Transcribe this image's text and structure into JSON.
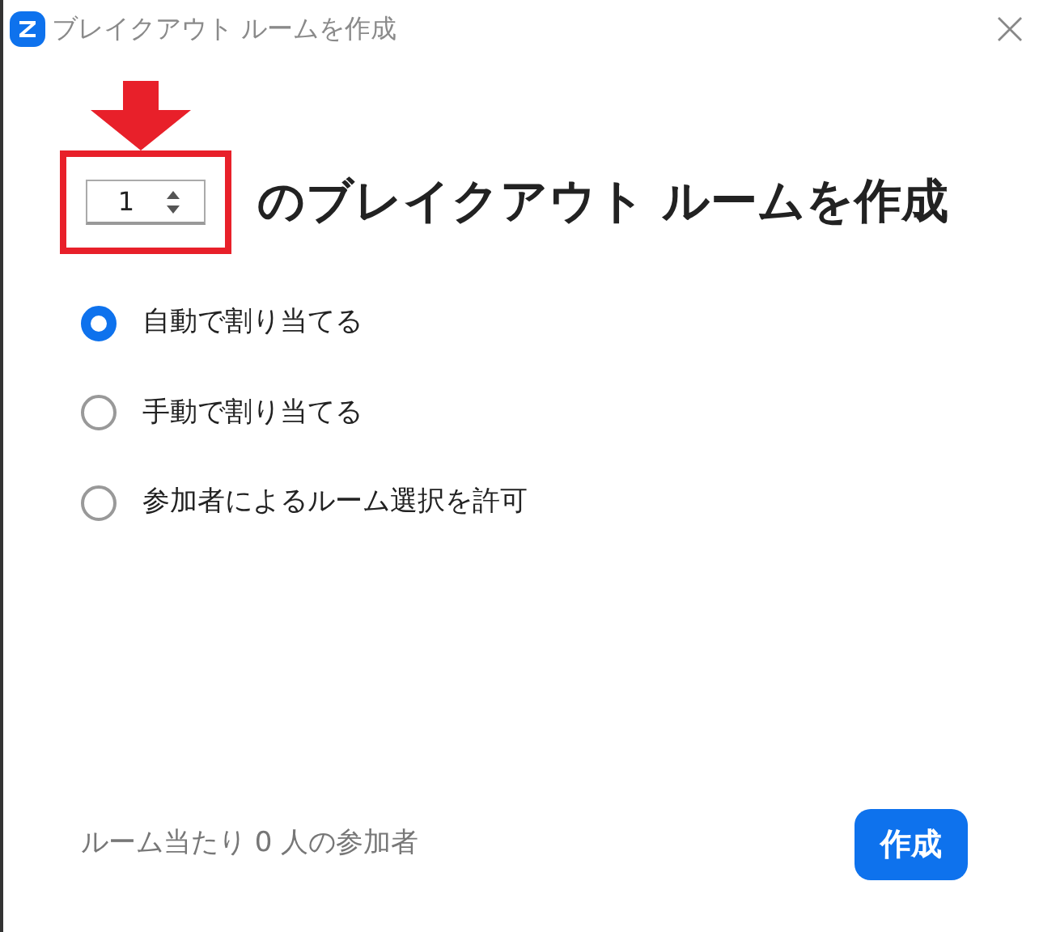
{
  "window": {
    "title": "ブレイクアウト ルームを作成"
  },
  "room_count": {
    "value": "1"
  },
  "headline": "のブレイクアウト ルームを作成",
  "options": [
    {
      "label": "自動で割り当てる",
      "selected": true
    },
    {
      "label": "手動で割り当てる",
      "selected": false
    },
    {
      "label": "参加者によるルーム選択を許可",
      "selected": false
    }
  ],
  "footer": {
    "participants": "ルーム当たり 0 人の参加者",
    "create_button": "作成"
  }
}
